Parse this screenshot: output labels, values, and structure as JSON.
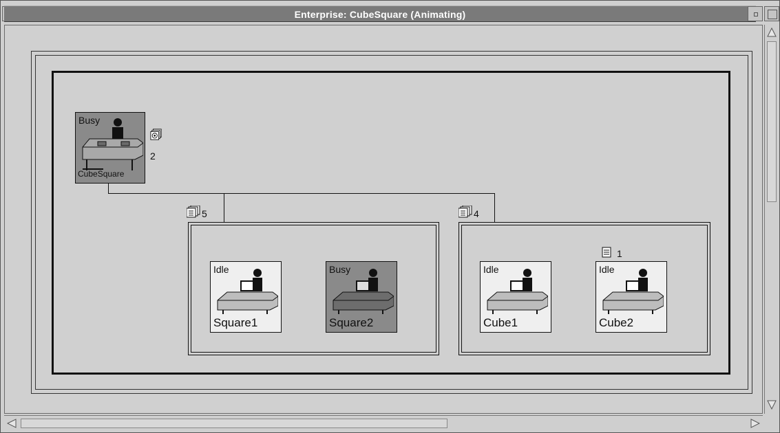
{
  "window": {
    "title": "Enterprise: CubeSquare (Animating)",
    "buttons": [
      "window-menu",
      "minimize",
      "maximize"
    ]
  },
  "root": {
    "status": "Busy",
    "name": "CubeSquare",
    "queue_count": "2"
  },
  "groups": [
    {
      "queue_count": "5",
      "workstations": [
        {
          "status": "Idle",
          "name": "Square1",
          "busy": false
        },
        {
          "status": "Busy",
          "name": "Square2",
          "busy": true
        }
      ]
    },
    {
      "queue_count": "4",
      "workstations": [
        {
          "status": "Idle",
          "name": "Cube1",
          "busy": false,
          "queue_count": ""
        },
        {
          "status": "Idle",
          "name": "Cube2",
          "busy": false,
          "queue_count": "1"
        }
      ]
    }
  ],
  "colors": {
    "titlebar": "#7a7a7a",
    "busy_fill": "#8a8a8a",
    "idle_fill": "#efefef",
    "canvas": "#d0d0d0"
  },
  "icons": {
    "queue": "document-stack-icon",
    "worker": "person-at-desk-icon",
    "token": "disk-stack-icon"
  }
}
